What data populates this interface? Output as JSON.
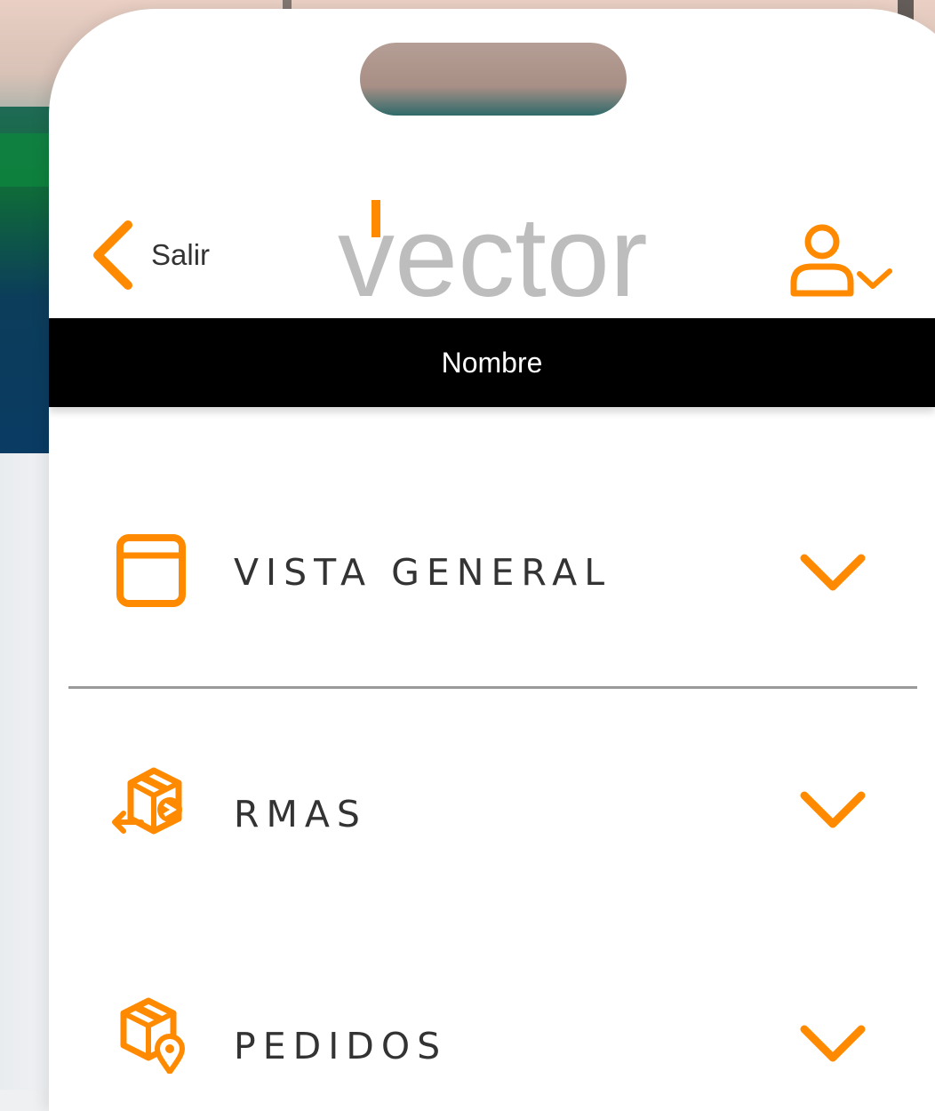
{
  "header": {
    "back_label": "Salir",
    "logo_text": "vector",
    "username_bar": "Nombre"
  },
  "menu": {
    "items": [
      {
        "label": "VISTA GENERAL",
        "icon": "window-icon"
      },
      {
        "label": "RMAS",
        "icon": "box-return-icon"
      },
      {
        "label": "PEDIDOS",
        "icon": "box-location-icon"
      }
    ]
  },
  "colors": {
    "accent": "#FF8A00",
    "logo_grey": "#BDBDBD",
    "bar": "#000000"
  }
}
